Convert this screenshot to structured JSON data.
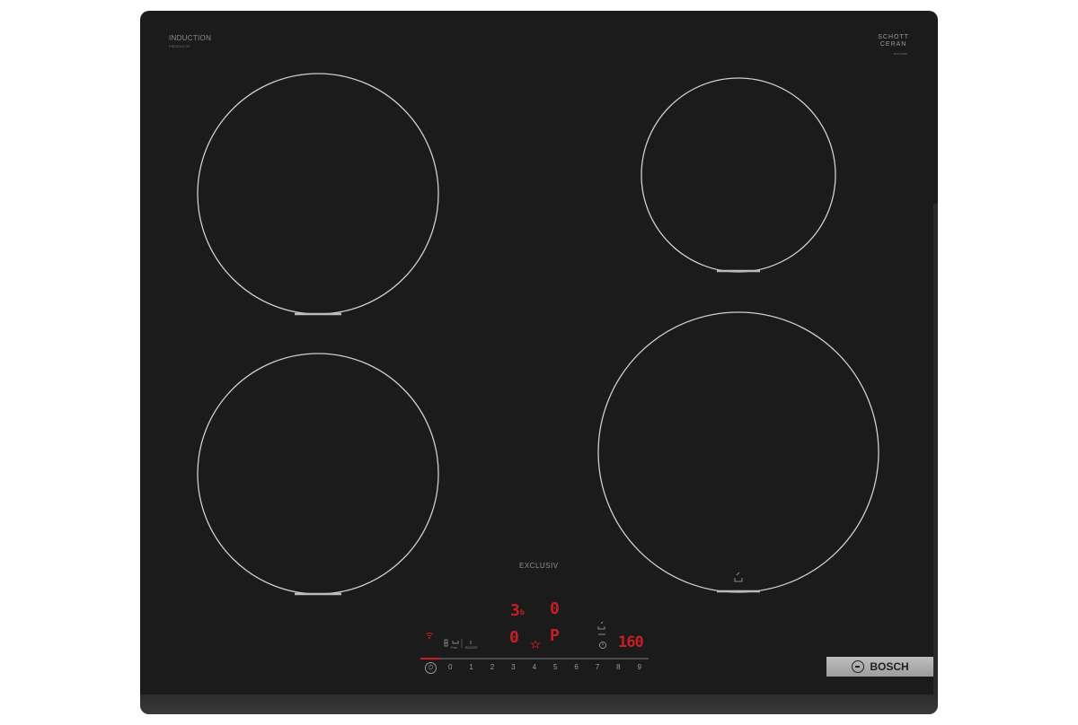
{
  "branding": {
    "type_label": "INDUCTION",
    "model_number": "PIE631HC1E",
    "glass_brand_line1": "SCHOTT",
    "glass_brand_line2": "CERAN",
    "glass_code": "EC6 03000",
    "series_label": "EXCLUSIV",
    "manufacturer": "BOSCH"
  },
  "displays": {
    "top_left": "3",
    "top_left_sub": "b",
    "top_right": "0",
    "bottom_left": "0",
    "bottom_right_zone": "P",
    "timer": "160"
  },
  "controls": {
    "power_symbol": "⏻",
    "scale": [
      "0",
      "1",
      "2",
      "3",
      "4",
      "5",
      "6",
      "7",
      "8",
      "9"
    ],
    "icon_labels": {
      "pan": "Pan",
      "boost": "BOOST"
    }
  },
  "colors": {
    "glass": "#1b1b1b",
    "zone_outline": "#cfcfcf",
    "display_red": "#c81d26"
  }
}
